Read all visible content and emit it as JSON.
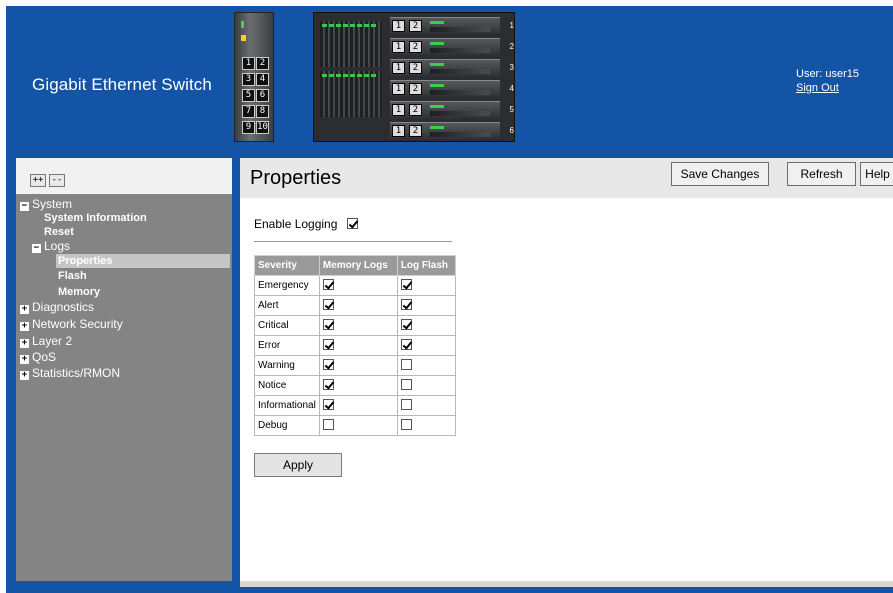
{
  "header": {
    "app_title": "Gigabit Ethernet Switch",
    "user_label": "User: user15",
    "sign_out": "Sign Out",
    "brand_color": "#1454a7"
  },
  "device": {
    "stack_ports": [
      "1",
      "2",
      "3",
      "4",
      "5",
      "6",
      "7",
      "8",
      "9",
      "10"
    ],
    "unit_buttons": [
      "1",
      "2"
    ],
    "unit_numbers": [
      "1",
      "2",
      "3",
      "4",
      "5",
      "6"
    ]
  },
  "nav": {
    "expand_all": "++",
    "collapse_all": "--",
    "items": [
      {
        "label": "System",
        "toggle": "−"
      },
      {
        "label": "System Information"
      },
      {
        "label": "Reset"
      },
      {
        "label": "Logs",
        "toggle": "−"
      },
      {
        "label": "Properties",
        "selected": true
      },
      {
        "label": "Flash"
      },
      {
        "label": "Memory"
      },
      {
        "label": "Diagnostics",
        "toggle": "+"
      },
      {
        "label": "Network Security",
        "toggle": "+"
      },
      {
        "label": "Layer 2",
        "toggle": "+"
      },
      {
        "label": "QoS",
        "toggle": "+"
      },
      {
        "label": "Statistics/RMON",
        "toggle": "+"
      }
    ]
  },
  "page": {
    "title": "Properties",
    "buttons": {
      "save": "Save Changes",
      "refresh": "Refresh",
      "help": "Help"
    },
    "enable_logging_label": "Enable Logging",
    "enable_logging": true,
    "apply": "Apply"
  },
  "severity_table": {
    "headers": [
      "Severity",
      "Memory Logs",
      "Log Flash"
    ],
    "rows": [
      {
        "severity": "Emergency",
        "memory": true,
        "flash": true
      },
      {
        "severity": "Alert",
        "memory": true,
        "flash": true
      },
      {
        "severity": "Critical",
        "memory": true,
        "flash": true
      },
      {
        "severity": "Error",
        "memory": true,
        "flash": true
      },
      {
        "severity": "Warning",
        "memory": true,
        "flash": false
      },
      {
        "severity": "Notice",
        "memory": true,
        "flash": false
      },
      {
        "severity": "Informational",
        "memory": true,
        "flash": false
      },
      {
        "severity": "Debug",
        "memory": false,
        "flash": false
      }
    ]
  }
}
